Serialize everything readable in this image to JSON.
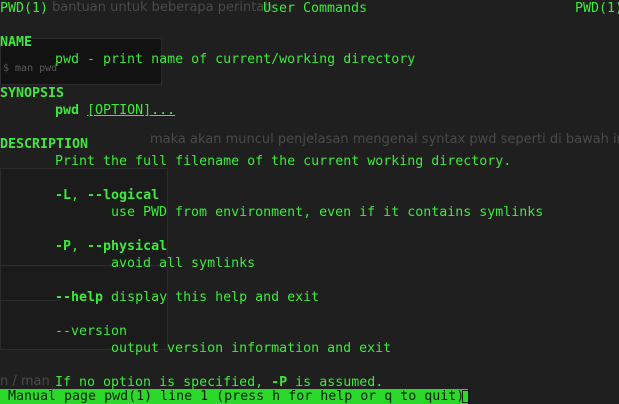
{
  "background": {
    "top_line": "bantuan untuk beberapa perintah",
    "box_text": "$ man pwd",
    "mid_line": "maka akan muncul penjelasan mengenai syntax pwd seperti di bawah ini :",
    "bottom_line": "n / man"
  },
  "header": {
    "left": "PWD(1)",
    "center": "User Commands",
    "right": "PWD(1)"
  },
  "sections": {
    "name_heading": "NAME",
    "name_text": "pwd - print name of current/working directory",
    "synopsis_heading": "SYNOPSIS",
    "synopsis_cmd": "pwd",
    "synopsis_opt": "[OPTION]...",
    "description_heading": "DESCRIPTION",
    "description_text": "Print the full filename of the current working directory."
  },
  "options": {
    "logical_flag_short": "-L",
    "logical_flag_sep": ", ",
    "logical_flag_long": "--logical",
    "logical_desc": "use PWD from environment, even if it contains symlinks",
    "physical_flag_short": "-P",
    "physical_flag_sep": ", ",
    "physical_flag_long": "--physical",
    "physical_desc": "avoid all symlinks",
    "help_flag": "--help",
    "help_desc": " display this help and exit",
    "version_flag": "--version",
    "version_desc": "output version information and exit",
    "note_before": "If no option is specified, ",
    "note_flag": "-P",
    "note_after": " is assumed."
  },
  "status_bar": {
    "text": " Manual page pwd(1) line 1 (press h for help or q to quit)"
  },
  "colors": {
    "terminal_text": "#3ee83e",
    "status_bg": "#2ad92a",
    "background": "#1f1f1f"
  }
}
